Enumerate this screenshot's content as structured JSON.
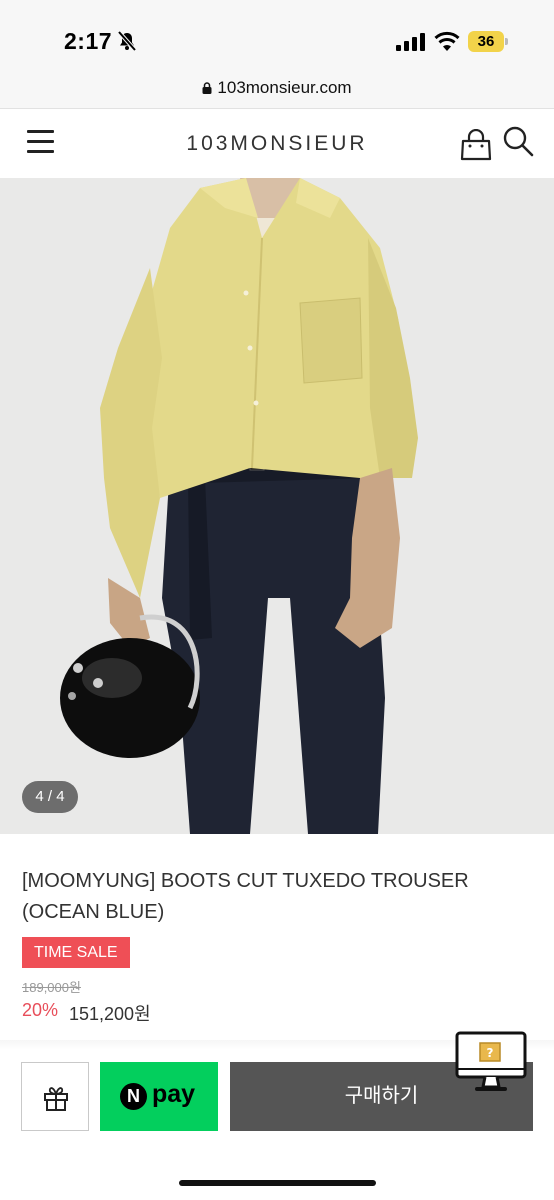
{
  "status_bar": {
    "time": "2:17",
    "battery": "36"
  },
  "browser": {
    "url": "103monsieur.com"
  },
  "header": {
    "logo": "103MONSIEUR"
  },
  "gallery": {
    "counter": "4 / 4"
  },
  "product": {
    "title": "[MOOMYUNG] BOOTS CUT TUXEDO TROUSER (OCEAN BLUE)",
    "badge": "TIME SALE",
    "original_price": "189,000원",
    "discount": "20%",
    "sale_price": "151,200원"
  },
  "actions": {
    "npay_n": "N",
    "npay_label": "pay",
    "buy_label": "구매하기"
  },
  "colors": {
    "sale_badge": "#ef4f56",
    "npay": "#03cf5d",
    "buy_button": "#555555",
    "discount_text": "#e84e5a"
  },
  "icons": [
    "bell-off-icon",
    "signal-icon",
    "wifi-icon",
    "lock-icon",
    "menu-icon",
    "bag-icon",
    "search-icon",
    "gift-icon",
    "monitor-icon"
  ]
}
